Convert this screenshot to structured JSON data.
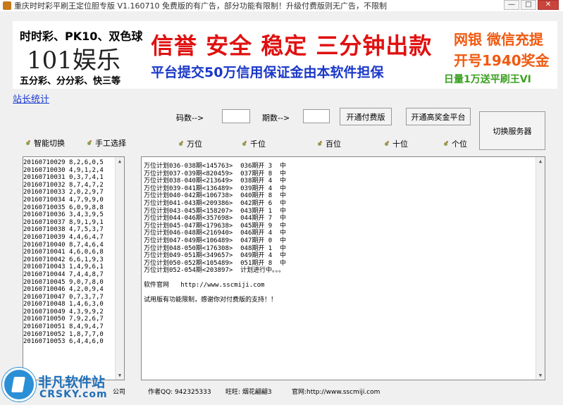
{
  "window": {
    "title": "重庆时时彩平刷王定位胆专版    V1.160710    免费版的有广告，部分功能有限制！升级付费版则无广告，不限制",
    "min_label": "—",
    "max_label": "□",
    "close_label": "✕"
  },
  "banner": {
    "left_line1": "时时彩、PK10、双色球",
    "left_line2": "101娱乐",
    "left_line3": "五分彩、分分彩、快三等",
    "mid_line1": "信誉 安全 稳定 三分钟出款",
    "mid_line2": "平台提交50万信用保证金由本软件担保",
    "right_line1": "网银 微信充提",
    "right_line2": "开号1940奖金",
    "right_line3": "日量1万送平刷王VI"
  },
  "stats_link": "站长统计",
  "controls": {
    "code_label": "码数-->",
    "period_label": "期数-->",
    "code_value": "",
    "period_value": "",
    "btn_open_paid": "开通付费版",
    "btn_open_high": "开通高奖金平台",
    "btn_switch_server": "切换服务器"
  },
  "radios": {
    "smart": "智能切换",
    "manual": "手工选择",
    "wan": "万位",
    "qian": "千位",
    "bai": "百位",
    "shi": "十位",
    "ge": "个位"
  },
  "history": [
    "20160710029 8,2,6,0,5",
    "20160710030 4,9,1,2,4",
    "20160710031 0,3,7,4,1",
    "20160710032 8,7,4,7,2",
    "20160710033 2,0,2,9,7",
    "20160710034 4,7,9,9,0",
    "20160710035 6,0,9,8,8",
    "20160710036 3,4,3,9,5",
    "20160710037 8,9,1,9,1",
    "20160710038 4,7,5,3,7",
    "20160710039 4,4,6,4,7",
    "20160710040 8,7,4,6,4",
    "20160710041 4,6,0,6,8",
    "20160710042 6,6,1,9,3",
    "20160710043 1,4,9,6,1",
    "20160710044 7,4,4,8,7",
    "20160710045 9,0,7,8,0",
    "20160710046 4,2,0,9,4",
    "20160710047 0,7,3,7,7",
    "20160710048 1,4,6,3,0",
    "20160710049 4,3,9,9,2",
    "20160710050 7,9,2,6,7",
    "20160710051 8,4,9,4,7",
    "20160710052 1,8,7,7,0",
    "20160710053 6,4,4,6,0"
  ],
  "output": {
    "lines": [
      "万位计划036-038期<145763>  036期开 3  中",
      "万位计划037-039期<820459>  037期开 8  中",
      "万位计划038-040期<213649>  038期开 4  中",
      "万位计划039-041期<136489>  039期开 4  中",
      "万位计划040-042期<106738>  040期开 8  中",
      "万位计划041-043期<209386>  042期开 6  中",
      "万位计划043-045期<158207>  043期开 1  中",
      "万位计划044-046期<357698>  044期开 7  中",
      "万位计划045-047期<179638>  045期开 9  中",
      "万位计划046-048期<216940>  046期开 4  中",
      "万位计划047-049期<106489>  047期开 0  中",
      "万位计划048-050期<176308>  048期开 1  中",
      "万位计划049-051期<349657>  049期开 4  中",
      "万位计划050-052期<105489>  051期开 8  中",
      "万位计划052-054期<203897>  计划进行中。。。"
    ],
    "site_line": "软件官网   http://www.sscmiji.com",
    "notice": "试用版有功能限制，感谢你对付费版的支持！！"
  },
  "status": {
    "company": "公司",
    "author_qq": "作者QQ: 942325333",
    "wangwang": "旺旺: 烟花翩翩3",
    "website": "官网:http://www.sscmiji.com"
  },
  "watermark": {
    "cn": "非凡软件站",
    "en": "CRSKY.com"
  },
  "colors": {
    "banner_red": "#e01010",
    "banner_blue": "#1a38c8",
    "banner_orange": "#f05a10",
    "banner_green": "#3aa020",
    "link_blue": "#1a3bd0"
  }
}
